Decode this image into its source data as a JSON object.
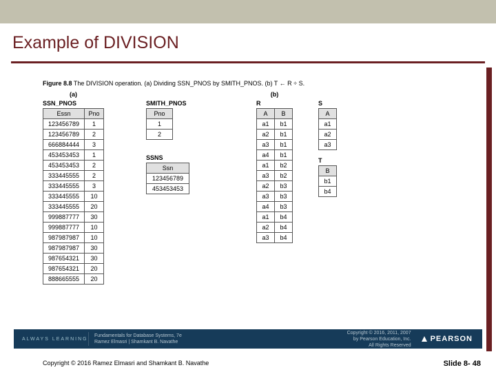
{
  "title": "Example of DIVISION",
  "figure": {
    "label": "Figure 8.8",
    "caption": "The DIVISION operation. (a) Dividing SSN_PNOS by SMITH_PNOS. (b) T ← R ÷ S."
  },
  "labels": {
    "a": "(a)",
    "b": "(b)"
  },
  "tables": {
    "ssn_pnos": {
      "name": "SSN_PNOS",
      "cols": [
        "Essn",
        "Pno"
      ],
      "rows": [
        [
          "123456789",
          "1"
        ],
        [
          "123456789",
          "2"
        ],
        [
          "666884444",
          "3"
        ],
        [
          "453453453",
          "1"
        ],
        [
          "453453453",
          "2"
        ],
        [
          "333445555",
          "2"
        ],
        [
          "333445555",
          "3"
        ],
        [
          "333445555",
          "10"
        ],
        [
          "333445555",
          "20"
        ],
        [
          "999887777",
          "30"
        ],
        [
          "999887777",
          "10"
        ],
        [
          "987987987",
          "10"
        ],
        [
          "987987987",
          "30"
        ],
        [
          "987654321",
          "30"
        ],
        [
          "987654321",
          "20"
        ],
        [
          "888665555",
          "20"
        ]
      ]
    },
    "smith_pnos": {
      "name": "SMITH_PNOS",
      "cols": [
        "Pno"
      ],
      "rows": [
        [
          "1"
        ],
        [
          "2"
        ]
      ]
    },
    "ssns": {
      "name": "SSNS",
      "cols": [
        "Ssn"
      ],
      "rows": [
        [
          "123456789"
        ],
        [
          "453453453"
        ]
      ]
    },
    "R": {
      "name": "R",
      "cols": [
        "A",
        "B"
      ],
      "rows": [
        [
          "a1",
          "b1"
        ],
        [
          "a2",
          "b1"
        ],
        [
          "a3",
          "b1"
        ],
        [
          "a4",
          "b1"
        ],
        [
          "a1",
          "b2"
        ],
        [
          "a3",
          "b2"
        ],
        [
          "a2",
          "b3"
        ],
        [
          "a3",
          "b3"
        ],
        [
          "a4",
          "b3"
        ],
        [
          "a1",
          "b4"
        ],
        [
          "a2",
          "b4"
        ],
        [
          "a3",
          "b4"
        ]
      ]
    },
    "S": {
      "name": "S",
      "cols": [
        "A"
      ],
      "rows": [
        [
          "a1"
        ],
        [
          "a2"
        ],
        [
          "a3"
        ]
      ]
    },
    "T": {
      "name": "T",
      "cols": [
        "B"
      ],
      "rows": [
        [
          "b1"
        ],
        [
          "b4"
        ]
      ]
    }
  },
  "band": {
    "always": "ALWAYS LEARNING",
    "book_line1": "Fundamentals for Database Systems, 7e",
    "book_line2": "Ramez Elmasri | Shamkant B. Navathe",
    "copy_line1": "Copyright © 2016, 2011, 2007",
    "copy_line2": "by Pearson Education, Inc.",
    "copy_line3": "All Rights Reserved",
    "brand": "PEARSON"
  },
  "footer": {
    "copyright": "Copyright © 2016 Ramez Elmasri and Shamkant B. Navathe",
    "slide": "Slide 8- 48"
  }
}
